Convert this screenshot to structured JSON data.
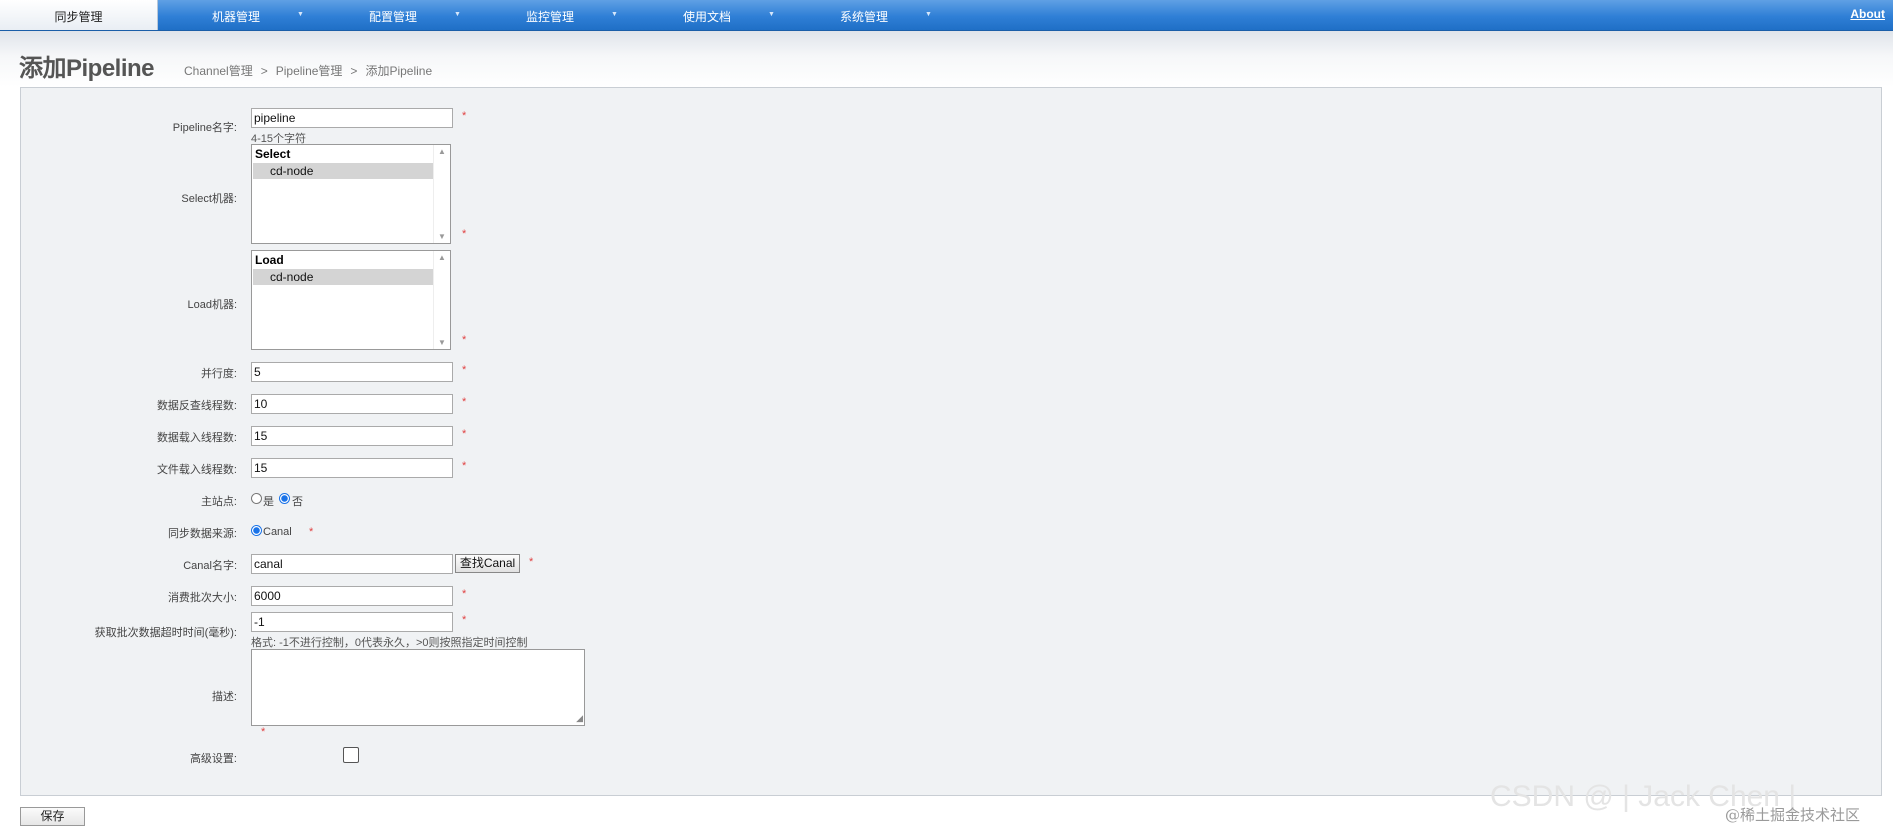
{
  "nav": {
    "items": [
      {
        "label": "同步管理",
        "active": true
      },
      {
        "label": "机器管理"
      },
      {
        "label": "配置管理"
      },
      {
        "label": "监控管理"
      },
      {
        "label": "使用文档"
      },
      {
        "label": "系统管理"
      }
    ],
    "arrow": "▼",
    "about": "About"
  },
  "header": {
    "title": "添加Pipeline",
    "breadcrumb": [
      "Channel管理",
      "Pipeline管理",
      "添加Pipeline"
    ],
    "breadcrumb_sep": ">"
  },
  "form": {
    "required_mark": "*",
    "pipeline_name": {
      "label": "Pipeline名字:",
      "value": "pipeline",
      "hint": "4-15个字符"
    },
    "select_machine": {
      "label": "Select机器:",
      "group": "Select",
      "option": "cd-node"
    },
    "load_machine": {
      "label": "Load机器:",
      "group": "Load",
      "option": "cd-node"
    },
    "parallelism": {
      "label": "并行度:",
      "value": "5"
    },
    "extract_threads": {
      "label": "数据反查线程数:",
      "value": "10"
    },
    "load_threads": {
      "label": "数据载入线程数:",
      "value": "15"
    },
    "file_load_threads": {
      "label": "文件载入线程数:",
      "value": "15"
    },
    "main_site": {
      "label": "主站点:",
      "yes": "是",
      "no": "否",
      "selected": "否"
    },
    "source": {
      "label": "同步数据来源:",
      "option": "Canal",
      "selected": "Canal"
    },
    "canal_name": {
      "label": "Canal名字:",
      "value": "canal",
      "button": "查找Canal"
    },
    "batch_size": {
      "label": "消费批次大小:",
      "value": "6000"
    },
    "batch_timeout": {
      "label": "获取批次数据超时时间(毫秒):",
      "value": "-1",
      "hint": "格式: -1不进行控制，0代表永久，>0则按照指定时间控制"
    },
    "description": {
      "label": "描述:",
      "value": ""
    },
    "advanced": {
      "label": "高级设置:",
      "checked": false
    }
  },
  "save_button": "保存",
  "watermark": {
    "ghost": "CSDN @ | Jack  Chen |",
    "text": "@稀土掘金技术社区"
  }
}
